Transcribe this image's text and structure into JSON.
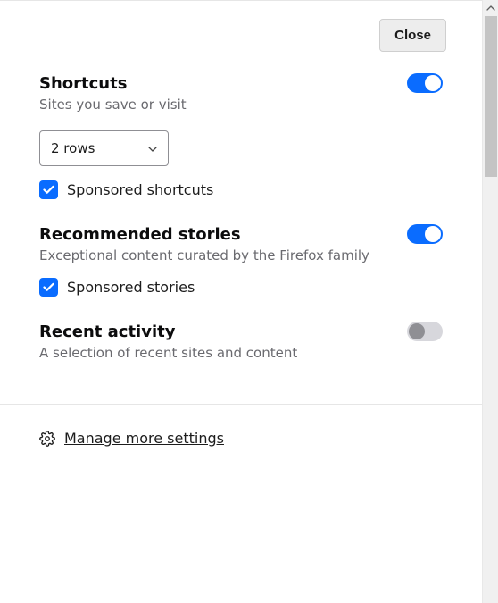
{
  "close_label": "Close",
  "shortcuts": {
    "title": "Shortcuts",
    "desc": "Sites you save or visit",
    "rows_value": "2 rows",
    "toggle_on": true,
    "sponsored_label": "Sponsored shortcuts",
    "sponsored_checked": true
  },
  "recommended": {
    "title": "Recommended stories",
    "desc": "Exceptional content curated by the Firefox family",
    "toggle_on": true,
    "sponsored_label": "Sponsored stories",
    "sponsored_checked": true
  },
  "recent": {
    "title": "Recent activity",
    "desc": "A selection of recent sites and content",
    "toggle_on": false
  },
  "manage_label": "Manage more settings",
  "icons": {
    "chevron_down": "chevron-down-icon",
    "checkmark": "checkmark-icon",
    "gear": "gear-icon",
    "scroll_up": "scroll-up-arrow-icon"
  },
  "colors": {
    "accent": "#0a6cff",
    "text_muted": "#6a6a6f",
    "toggle_off_bg": "#d7d7dc",
    "toggle_off_knob": "#8f8f94"
  }
}
